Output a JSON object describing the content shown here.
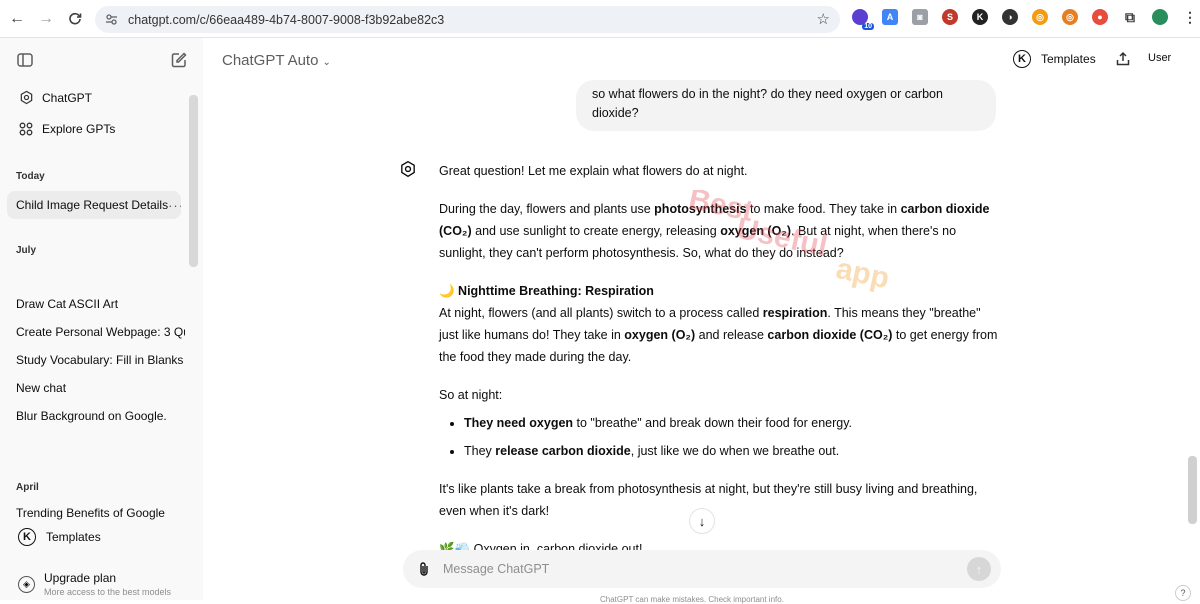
{
  "browser": {
    "url": "chatgpt.com/c/66eaa489-4b74-8007-9008-f3b92abe82c3",
    "extension_badge": "10"
  },
  "sidebar": {
    "nav_items": [
      {
        "label": "ChatGPT",
        "icon": "openai-logo-icon"
      },
      {
        "label": "Explore GPTs",
        "icon": "grid-icon"
      }
    ],
    "sections": [
      {
        "label": "Today",
        "chats": [
          "Child Image Request Details"
        ]
      },
      {
        "label": "July",
        "chats": [
          "Draw Cat ASCII Art",
          "Create Personal Webpage: 3 Qu",
          "Study Vocabulary: Fill in Blanks",
          "New chat",
          "Blur Background on Google."
        ]
      },
      {
        "label": "April",
        "chats": [
          "Trending Benefits of Google"
        ]
      }
    ],
    "active_chat_menu": "···",
    "templates_label": "Templates",
    "upgrade": {
      "title": "Upgrade plan",
      "subtitle": "More access to the best models"
    }
  },
  "header": {
    "model_label": "ChatGPT Auto",
    "templates_label": "Templates",
    "user_label": "User"
  },
  "conversation": {
    "user_message": "so what flowers do in the night? do they need oxygen or carbon dioxide?",
    "intro": "Great question! Let me explain what flowers do at night.",
    "p1": {
      "a": "During the day, flowers and plants use ",
      "b": "photosynthesis",
      "c": " to make food. They take in ",
      "d": "carbon dioxide (CO₂)",
      "e": " and use sunlight to create energy, releasing ",
      "f": "oxygen (O₂)",
      "g": ". But at night, when there's no sunlight, they can't perform photosynthesis. So, what do they do instead?"
    },
    "heading": "🌙 Nighttime Breathing: Respiration",
    "p2": {
      "a": "At night, flowers (and all plants) switch to a process called ",
      "b": "respiration",
      "c": ". This means they \"breathe\" just like humans do! They take in ",
      "d": "oxygen (O₂)",
      "e": " and release ",
      "f": "carbon dioxide (CO₂)",
      "g": " to get energy from the food they made during the day."
    },
    "so_at_night": "So at night:",
    "bullets": [
      {
        "bold": "They need oxygen",
        "rest": " to \"breathe\" and break down their food for energy."
      },
      {
        "pre": "They ",
        "bold": "release carbon dioxide",
        "rest": ", just like we do when we breathe out."
      }
    ],
    "p3": "It's like plants take a break from photosynthesis at night, but they're still busy living and breathing, even when it's dark!",
    "p4": "🌿💨 Oxygen in, carbon dioxide out!",
    "watermark": [
      "Best",
      "Useful",
      "app"
    ]
  },
  "composer": {
    "placeholder": "Message ChatGPT"
  },
  "footer_note": "ChatGPT can make mistakes. Check important info.",
  "help_label": "?"
}
